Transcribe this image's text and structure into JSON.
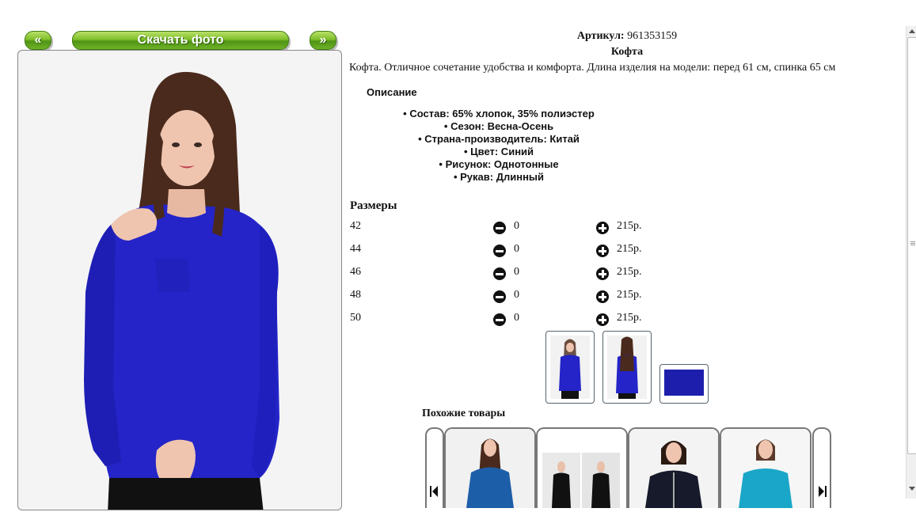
{
  "nav": {
    "prev_label": "«",
    "download_label": "Скачать фото",
    "next_label": "»"
  },
  "product": {
    "article_label": "Артикул:",
    "article_value": "961353159",
    "name": "Кофта",
    "summary": "Кофта. Отличное сочетание удобства и комфорта. Длина изделия на модели: перед 61 см, спинка 65 см",
    "description_title": "Описание",
    "properties": [
      "Состав: 65% хлопок, 35% полиэстер",
      "Сезон: Весна-Осень",
      "Страна-производитель: Китай",
      "Цвет: Синий",
      "Рисунок: Однотонные",
      "Рукав: Длинный"
    ],
    "color": "#2222c8"
  },
  "sizes": {
    "title": "Размеры",
    "rows": [
      {
        "size": "42",
        "qty": "0",
        "price": "215р."
      },
      {
        "size": "44",
        "qty": "0",
        "price": "215р."
      },
      {
        "size": "46",
        "qty": "0",
        "price": "215р."
      },
      {
        "size": "48",
        "qty": "0",
        "price": "215р."
      },
      {
        "size": "50",
        "qty": "0",
        "price": "215р."
      }
    ]
  },
  "similar": {
    "title": "Похожие товары"
  },
  "icons": {
    "minus": "minus-circle-icon",
    "plus": "plus-circle-icon",
    "first": "skip-first-icon",
    "last": "skip-last-icon"
  }
}
